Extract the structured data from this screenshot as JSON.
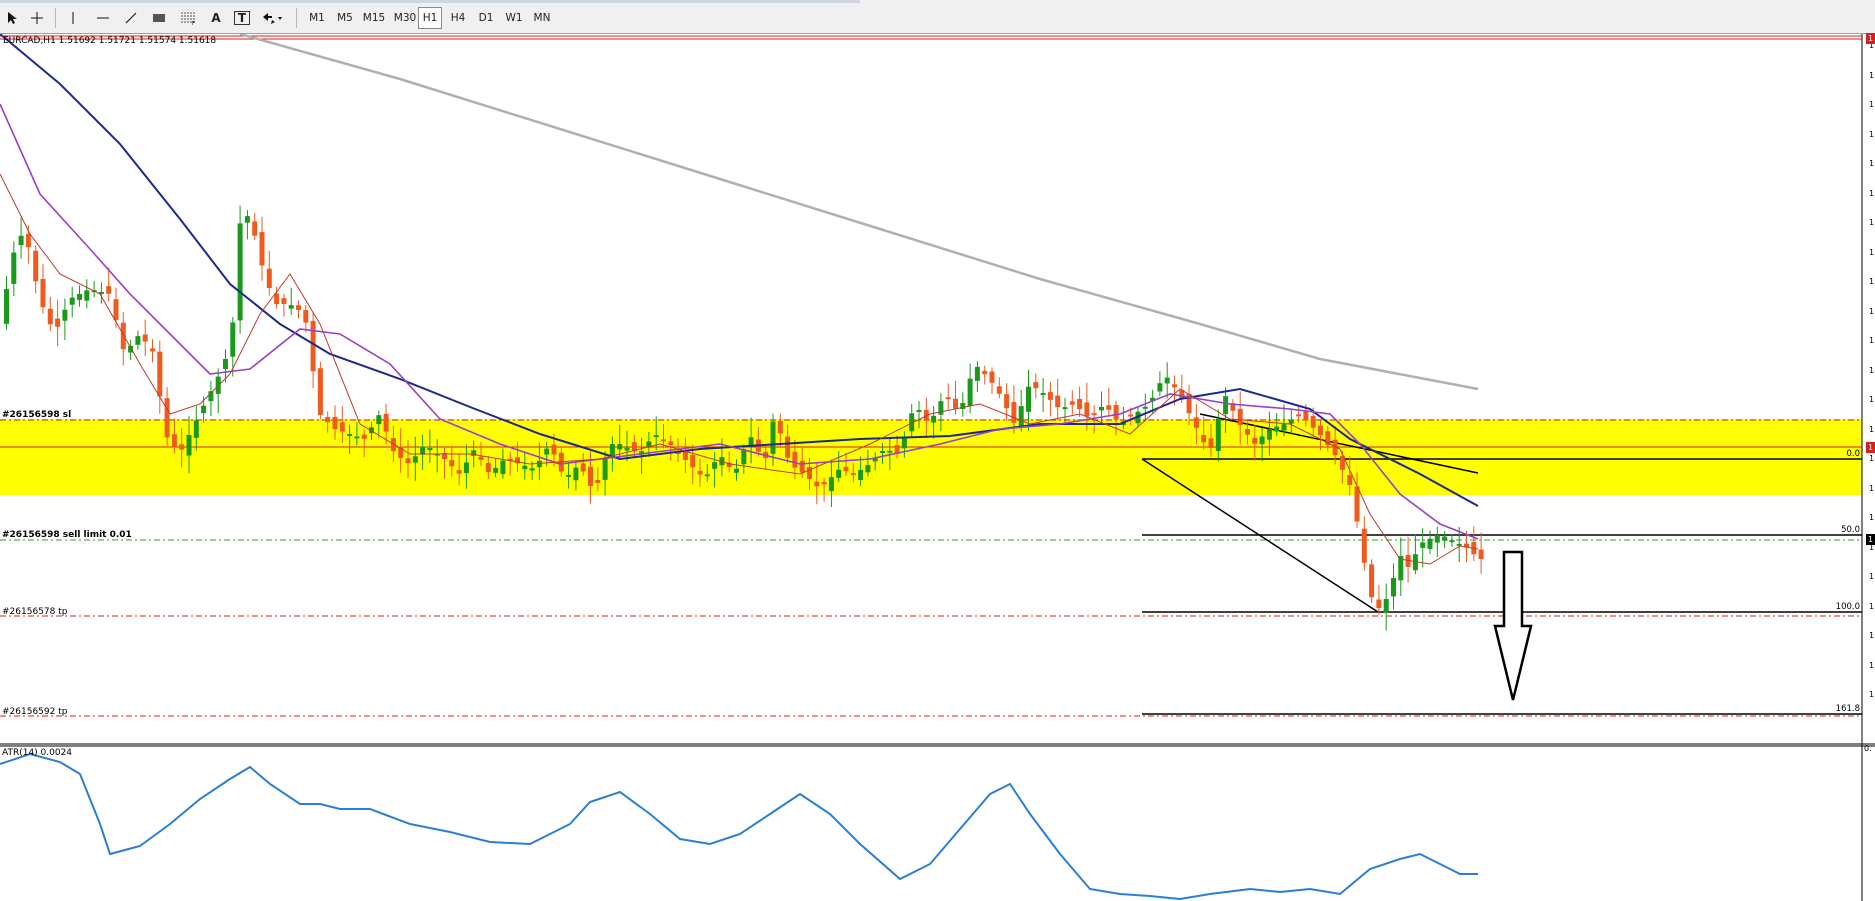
{
  "toolbar": {
    "tools": [
      {
        "name": "cursor-icon"
      },
      {
        "name": "crosshair-icon"
      },
      {
        "name": "vertical-line-icon"
      },
      {
        "name": "horizontal-line-icon"
      },
      {
        "name": "trendline-icon"
      },
      {
        "name": "rectangle-icon"
      },
      {
        "name": "fibonacci-icon"
      },
      {
        "name": "text-icon",
        "label": "A"
      },
      {
        "name": "text-label-icon",
        "label": "T"
      },
      {
        "name": "arrows-menu-icon"
      }
    ],
    "timeframes": [
      "M1",
      "M5",
      "M15",
      "M30",
      "H1",
      "H4",
      "D1",
      "W1",
      "MN"
    ],
    "active_timeframe": "H1"
  },
  "chart": {
    "symbol_info": "EURCAD,H1  1.51692 1.51721 1.51574 1.51618",
    "orders": {
      "sl_label": "#26156598 sl",
      "sell_limit_label": "#26156598 sell limit 0.01",
      "tp1_label": "#26156578 tp",
      "tp2_label": "#26156592 tp"
    },
    "fib_levels": {
      "level_0": "0.0",
      "level_50": "50.0",
      "level_100": "100.0",
      "level_161": "161.8"
    },
    "right_axis_ticks": [
      "1",
      "1",
      "1",
      "1",
      "1",
      "1",
      "1",
      "1",
      "1",
      "1",
      "1",
      "1",
      "1",
      "1",
      "1",
      "1",
      "1",
      "1",
      "1",
      "1",
      "1",
      "1",
      "1"
    ],
    "price_badges": [
      "1",
      "1",
      "1"
    ],
    "colors": {
      "bull_candle": "#1a9a1a",
      "bear_candle": "#f05a1e",
      "ma_fast": "#c0392b",
      "ma_mid": "#9b3fc6",
      "ma_slow": "#1c2a8c",
      "ma_long": "#b0b0b0",
      "zone": "#ffff00",
      "atr_line": "#2a7fd4",
      "order_line": "#d42020"
    }
  },
  "indicator": {
    "label": "ATR(14) 0.0024",
    "right_tick": "0."
  }
}
